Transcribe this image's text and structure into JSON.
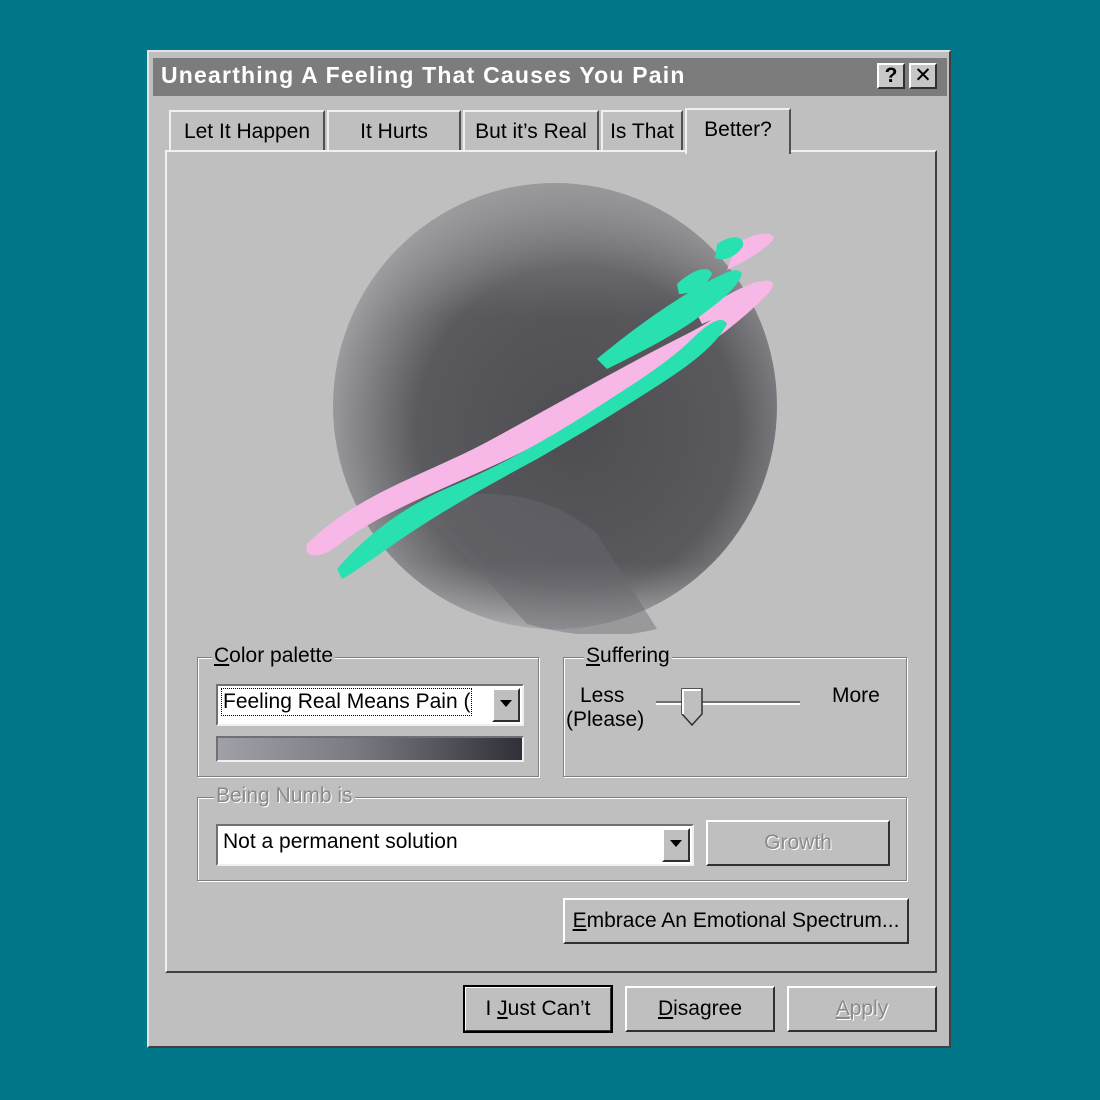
{
  "window": {
    "title": "Unearthing A Feeling That Causes You Pain",
    "help_button": "?",
    "close_button": "✕"
  },
  "tabs": [
    {
      "label": "Let It Happen"
    },
    {
      "label": "It Hurts"
    },
    {
      "label": "But it’s Real"
    },
    {
      "label": "Is That"
    },
    {
      "label": "Better?",
      "active": true
    }
  ],
  "preview": {
    "sphere_colors": [
      "#4e4e52",
      "#9a999c"
    ],
    "stroke_colors": {
      "pink": "#f7b8e8",
      "teal": "#28e0b0"
    }
  },
  "color_palette": {
    "legend_initial": "C",
    "legend_rest": "olor palette",
    "selected": "Feeling Real Means Pain (",
    "swatch": [
      "#a0a0a8",
      "#303038"
    ]
  },
  "suffering": {
    "legend_initial": "S",
    "legend_rest": "uffering",
    "less_label": "Less",
    "less_sub": "(Please)",
    "more_label": "More",
    "slider_fraction": 0.25
  },
  "numb": {
    "legend": "Being Numb is",
    "selected": "Not a permanent solution",
    "growth_button": "Growth"
  },
  "embrace_button": {
    "initial": "E",
    "rest": "mbrace An Emotional Spectrum..."
  },
  "footer": {
    "cant_prefix": "I ",
    "cant_initial": "J",
    "cant_rest": "ust Can’t",
    "disagree_initial": "D",
    "disagree_rest": "isagree",
    "apply_initial": "A",
    "apply_rest": "pply"
  },
  "accent_colors": {
    "desktop": "#00788a",
    "face": "#c0bfc0",
    "titlebar": "#7c7c7c"
  }
}
